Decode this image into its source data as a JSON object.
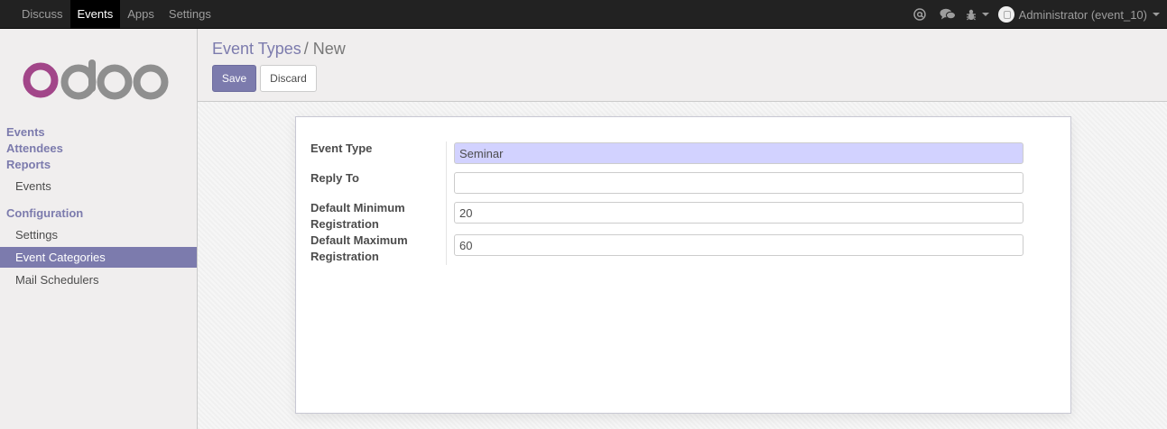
{
  "topbar": {
    "menu": [
      "Discuss",
      "Events",
      "Apps",
      "Settings"
    ],
    "active_menu": "Events",
    "icons": [
      "at-icon",
      "chat-icon",
      "bug-icon"
    ],
    "user_label": "Administrator (event_10)"
  },
  "sidebar": {
    "logo_text": "odoo",
    "sections": {
      "events": "Events",
      "attendees": "Attendees",
      "reports": "Reports",
      "reports_events": "Events",
      "configuration": "Configuration"
    },
    "config_items": [
      "Settings",
      "Event Categories",
      "Mail Schedulers"
    ],
    "active_config_item": "Event Categories"
  },
  "breadcrumb": {
    "parent": "Event Types",
    "separator": "/",
    "current": "New"
  },
  "buttons": {
    "save": "Save",
    "discard": "Discard"
  },
  "form": {
    "event_type_label": "Event Type",
    "event_type_value": "Seminar",
    "reply_to_label": "Reply To",
    "reply_to_value": "",
    "min_reg_label_line1": "Default Minimum",
    "min_reg_label_line2": "Registration",
    "min_reg_value": "20",
    "max_reg_label_line1": "Default Maximum",
    "max_reg_label_line2": "Registration",
    "max_reg_value": "60"
  },
  "colors": {
    "brand": "#7c7bad",
    "topbar": "#222222",
    "required_field": "#d2d2ff"
  }
}
